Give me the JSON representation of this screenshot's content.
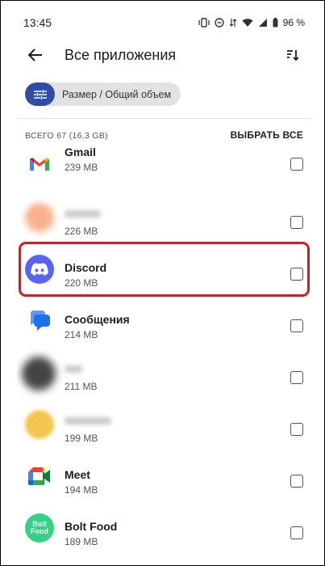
{
  "status_bar": {
    "time": "13:45",
    "battery": "96 %"
  },
  "app_bar": {
    "title": "Все приложения",
    "back_icon": "arrow-left-icon",
    "sort_icon": "sort-icon"
  },
  "filter": {
    "label": "Размер / Общий объем",
    "icon": "tune-icon"
  },
  "summary": {
    "text": "ВСЕГО 67 (16,3 GB)",
    "select_all": "ВЫБРАТЬ ВСЕ"
  },
  "apps": [
    {
      "name": "Gmail",
      "size": "239 MB",
      "icon": "gmail-icon",
      "blurred": false
    },
    {
      "name": "",
      "size": "226 MB",
      "icon": "blurred-app-icon",
      "blurred": true
    },
    {
      "name": "Discord",
      "size": "220 MB",
      "icon": "discord-icon",
      "blurred": false
    },
    {
      "name": "Сообщения",
      "size": "214 MB",
      "icon": "messages-icon",
      "blurred": false
    },
    {
      "name": "",
      "size": "211 MB",
      "icon": "blurred-app-icon",
      "blurred": true
    },
    {
      "name": "",
      "size": "199 MB",
      "icon": "blurred-app-icon",
      "blurred": true
    },
    {
      "name": "Meet",
      "size": "194 MB",
      "icon": "meet-icon",
      "blurred": false
    },
    {
      "name": "Bolt Food",
      "size": "189 MB",
      "icon": "bolt-food-icon",
      "blurred": false
    }
  ],
  "bolt_icon_text": "Bolt\nFood",
  "colors": {
    "accent": "#2f4da5",
    "highlight": "#e0161c",
    "discord": "#5865f2",
    "bolt": "#34d186"
  }
}
